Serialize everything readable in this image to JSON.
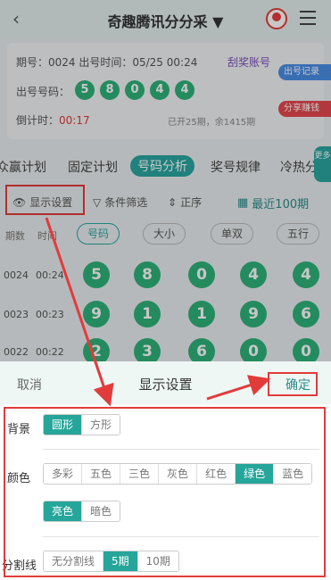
{
  "header": {
    "back_icon": "‹",
    "title": "奇趣腾讯分分采 ▼"
  },
  "info": {
    "issue_line": "期号：0024  出号时间：05/25 00:24",
    "link": "刮奖账号",
    "numbers_label": "出号号码：",
    "numbers": [
      "5",
      "8",
      "0",
      "4",
      "4"
    ],
    "countdown_label": "倒计时：",
    "countdown": "00:17",
    "stats": "已开25期，余1415期",
    "tag_record": "出号记录",
    "tag_share": "分享赚钱"
  },
  "tabs": [
    "众赢计划",
    "固定计划",
    "号码分析",
    "奖号规律",
    "冷热分"
  ],
  "tabs_active": 2,
  "more_tag": "更多",
  "tools": {
    "display": "显示设置",
    "filter": "条件筛选",
    "order": "正序",
    "recent": "最近100期"
  },
  "subhead": {
    "col_issue": "期数",
    "col_time": "时间",
    "pills": [
      "号码",
      "大小",
      "单双",
      "五行"
    ]
  },
  "rows": [
    {
      "issue": "0024",
      "time": "00:24",
      "nums": [
        "5",
        "8",
        "0",
        "4",
        "4"
      ]
    },
    {
      "issue": "0023",
      "time": "00:23",
      "nums": [
        "9",
        "1",
        "1",
        "9",
        "6"
      ]
    },
    {
      "issue": "0022",
      "time": "00:22",
      "nums": [
        "2",
        "3",
        "6",
        "0",
        "0"
      ]
    }
  ],
  "panel": {
    "cancel": "取消",
    "title": "显示设置",
    "confirm": "确定",
    "bg_label": "背景",
    "bg_options": [
      "圆形",
      "方形"
    ],
    "color_label": "颜色",
    "color_options": [
      "多彩",
      "五色",
      "三色",
      "灰色",
      "红色",
      "绿色",
      "蓝色"
    ],
    "tone_options": [
      "亮色",
      "暗色"
    ],
    "divider_label": "分割线",
    "divider_options": [
      "无分割线",
      "5期",
      "10期"
    ]
  },
  "colors": {
    "accent": "#2aa6a0",
    "ball": "#2fb27a",
    "annotation": "#e23b3b"
  }
}
